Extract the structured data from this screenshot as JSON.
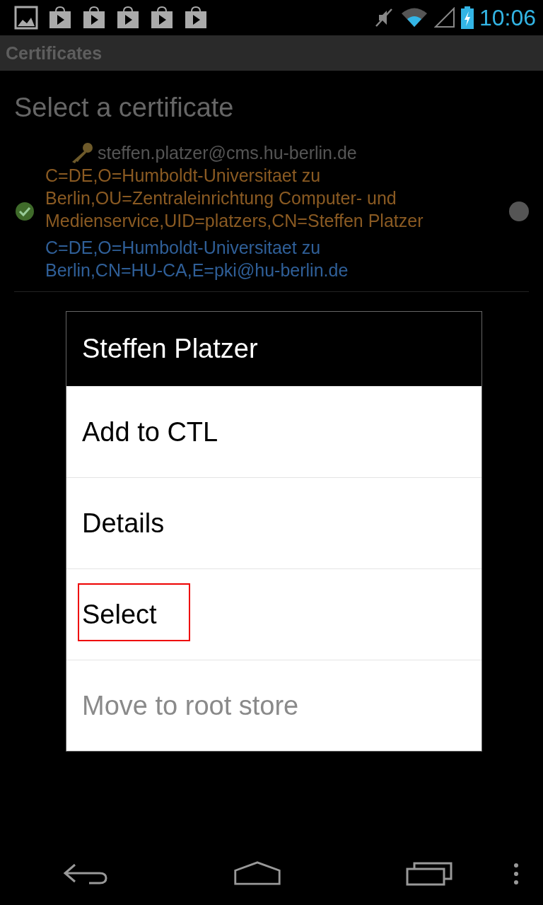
{
  "status_bar": {
    "time": "10:06"
  },
  "action_bar": {
    "title": "Certificates"
  },
  "heading": "Select a certificate",
  "certificates": [
    {
      "name": "steffen.platzer@cms.hu-berlin.de",
      "subject": "C=DE,O=Humboldt-Universitaet zu Berlin,OU=Zentraleinrichtung Computer- und Medienservice,UID=platzers,CN=Steffen Platzer",
      "issuer": "C=DE,O=Humboldt-Universitaet zu Berlin,CN=HU-CA,E=pki@hu-berlin.de",
      "trusted": true,
      "selected": false
    }
  ],
  "dialog": {
    "title": "Steffen Platzer",
    "items": [
      {
        "label": "Add to CTL",
        "disabled": false,
        "highlighted": false
      },
      {
        "label": "Details",
        "disabled": false,
        "highlighted": false
      },
      {
        "label": "Select",
        "disabled": false,
        "highlighted": true
      },
      {
        "label": "Move to root store",
        "disabled": true,
        "highlighted": false
      }
    ]
  }
}
